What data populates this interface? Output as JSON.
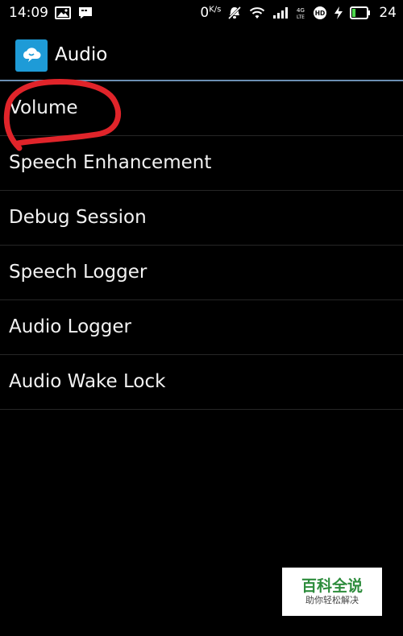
{
  "status_bar": {
    "time": "14:09",
    "speed_value": "0",
    "speed_unit": "K/s",
    "network_label": "4G LTE",
    "hd_label": "HD",
    "battery_level": "24"
  },
  "action_bar": {
    "title": "Audio",
    "app_icon": "cloud-chat-icon"
  },
  "list": {
    "items": [
      {
        "label": "Volume"
      },
      {
        "label": "Speech Enhancement"
      },
      {
        "label": "Debug Session"
      },
      {
        "label": "Speech Logger"
      },
      {
        "label": "Audio Logger"
      },
      {
        "label": "Audio Wake Lock"
      }
    ]
  },
  "annotation": {
    "color": "#e0242a",
    "target": "Volume"
  },
  "watermark": {
    "title": "百科全说",
    "subtitle": "助你轻松解决"
  },
  "colors": {
    "background": "#000000",
    "divider_accent": "#6c8fb3",
    "app_icon_bg": "#1e9bd7"
  }
}
